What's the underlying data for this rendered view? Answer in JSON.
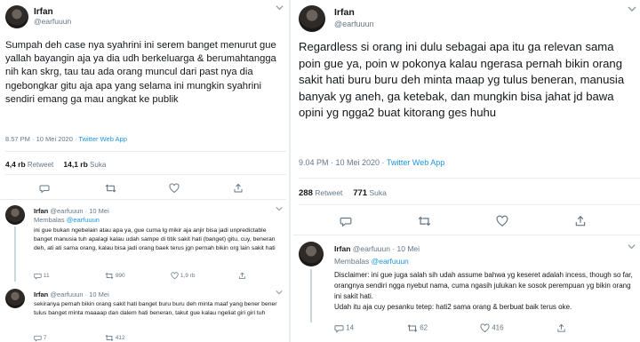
{
  "colors": {
    "accent": "#1b95e0",
    "muted": "#657786",
    "text": "#14171a",
    "divider": "#e6ecf0"
  },
  "left": {
    "user": {
      "name": "Irfan",
      "handle": "@earfuuun"
    },
    "tweet": {
      "text": "Sumpah deh case nya syahrini ini serem banget menurut gue yallah bayangin aja ya dia udh berkeluarga & berumahtangga nih kan skrg, tau tau ada orang muncul dari past nya dia ngebongkar gitu aja apa yang selama ini mungkin syahrini sendiri emang ga mau angkat ke publik",
      "time": "8.57 PM · 10 Mei 2020 · ",
      "source": "Twitter Web App"
    },
    "stats": {
      "retweets": "4,4 rb",
      "retweets_label": "Retweet",
      "likes": "14,1 rb",
      "likes_label": "Suka"
    },
    "replies": [
      {
        "name": "Irfan",
        "handle": "@earfuuun · 10 Mei",
        "reply_to_label": "Membalas",
        "reply_to": "@earfuuun",
        "text": "ini gue bukan ngebelain atau apa ya, gue cuma lg mikir aja anjir bisa jadi unpredictable banget manusia tuh apalagi kalau udah sampe di titik sakit hati (banget) gitu, cuy, beneran deh, ati ati sama orang, kalau bisa jadi orang baek terus jgn pernah bikin org lain sakit hati",
        "reply_count": "11",
        "retweet_count": "990",
        "like_count": "1,9 rb"
      },
      {
        "name": "Irfan",
        "handle": "@earfuuun · 10 Mei",
        "reply_to_label": "",
        "reply_to": "",
        "text": "sekiranya pernah bikin orang sakit hati banget buru buru deh minta maaf yang bener bener tulus banget minta maaaap dan dalem hati beneran, takut gue kalau ngeliat giri giri tuh",
        "reply_count": "7",
        "retweet_count": "412",
        "like_count": ""
      }
    ]
  },
  "right": {
    "user": {
      "name": "Irfan",
      "handle": "@earfuuun"
    },
    "tweet": {
      "text": "Regardless si orang ini dulu sebagai apa itu ga relevan sama poin gue ya, poin w pokonya kalau ngerasa pernah bikin orang sakit hati buru buru deh minta maap yg tulus beneran, manusia banyak yg aneh, ga ketebak, dan mungkin bisa jahat jd bawa opini yg ngga2 buat kitorang ges huhu",
      "time": "9.04 PM · 10 Mei 2020 · ",
      "source": "Twitter Web App"
    },
    "stats": {
      "retweets": "288",
      "retweets_label": "Retweet",
      "likes": "771",
      "likes_label": "Suka"
    },
    "reply": {
      "name": "Irfan",
      "handle": "@earfuuun · 10 Mei",
      "reply_to_label": "Membalas",
      "reply_to": "@earfuuun",
      "text": "Disclaimer: ini gue juga salah sih udah assume bahwa yg keseret adalah incess, though so far, orangnya sendiri ngga nyebut nama, cuma ngasih julukan ke sosok perempuan yg bikin orang ini sakit hati.",
      "text2": "Udah itu aja cuy pesanku tetep: hati2 sama orang & berbuat baik terus oke.",
      "reply_count": "14",
      "retweet_count": "62",
      "like_count": "416"
    }
  },
  "icons": [
    "chevron-down-icon",
    "reply-icon",
    "retweet-icon",
    "like-icon",
    "share-icon"
  ]
}
